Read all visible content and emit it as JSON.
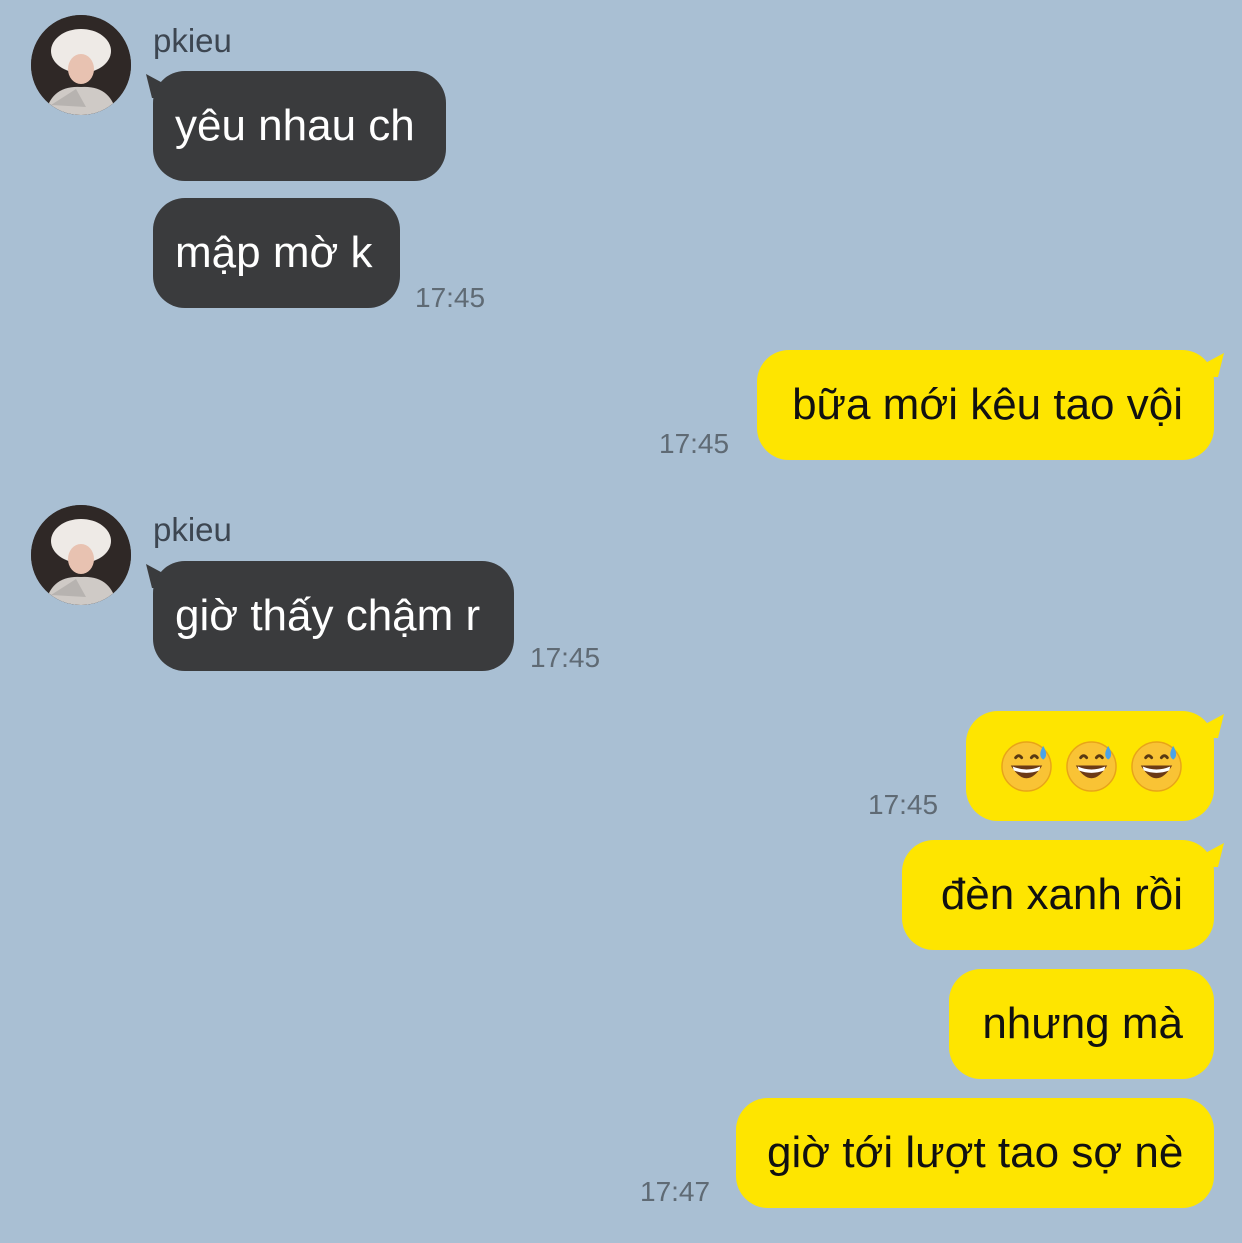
{
  "messages": [
    {
      "sender": "pkieu",
      "text": "yêu nhau ch"
    },
    {
      "text": "mập mờ k",
      "time": "17:45"
    },
    {
      "text": "bữa mới kêu tao vội",
      "time": "17:45"
    },
    {
      "sender": "pkieu",
      "text": "giờ thấy chậm r",
      "time": "17:45"
    },
    {
      "emoji": [
        "grinning-sweat-emoji",
        "grinning-sweat-emoji",
        "grinning-sweat-emoji"
      ],
      "time": "17:45"
    },
    {
      "text": "đèn xanh rồi"
    },
    {
      "text": "nhưng mà"
    },
    {
      "text": "giờ tới lượt tao sợ nè",
      "time": "17:47"
    }
  ],
  "colors": {
    "background": "#a9bfd3",
    "incoming_bubble": "#3a3b3d",
    "outgoing_bubble": "#fee500"
  }
}
